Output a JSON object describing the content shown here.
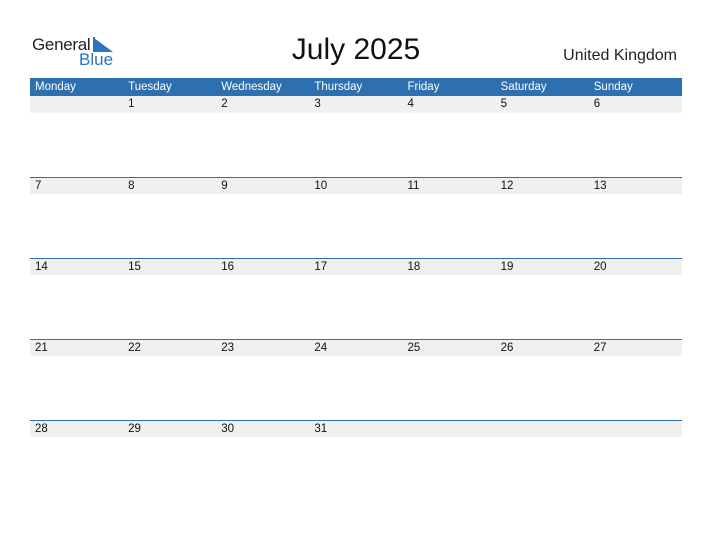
{
  "logo": {
    "line1": "General",
    "line2": "Blue"
  },
  "header": {
    "title": "July 2025",
    "country": "United Kingdom"
  },
  "colors": {
    "accent": "#2e6fb0",
    "band": "#f0f0f0"
  },
  "weekdays": [
    "Monday",
    "Tuesday",
    "Wednesday",
    "Thursday",
    "Friday",
    "Saturday",
    "Sunday"
  ],
  "weeks": [
    [
      "",
      "1",
      "2",
      "3",
      "4",
      "5",
      "6"
    ],
    [
      "7",
      "8",
      "9",
      "10",
      "11",
      "12",
      "13"
    ],
    [
      "14",
      "15",
      "16",
      "17",
      "18",
      "19",
      "20"
    ],
    [
      "21",
      "22",
      "23",
      "24",
      "25",
      "26",
      "27"
    ],
    [
      "28",
      "29",
      "30",
      "31",
      "",
      "",
      ""
    ]
  ]
}
